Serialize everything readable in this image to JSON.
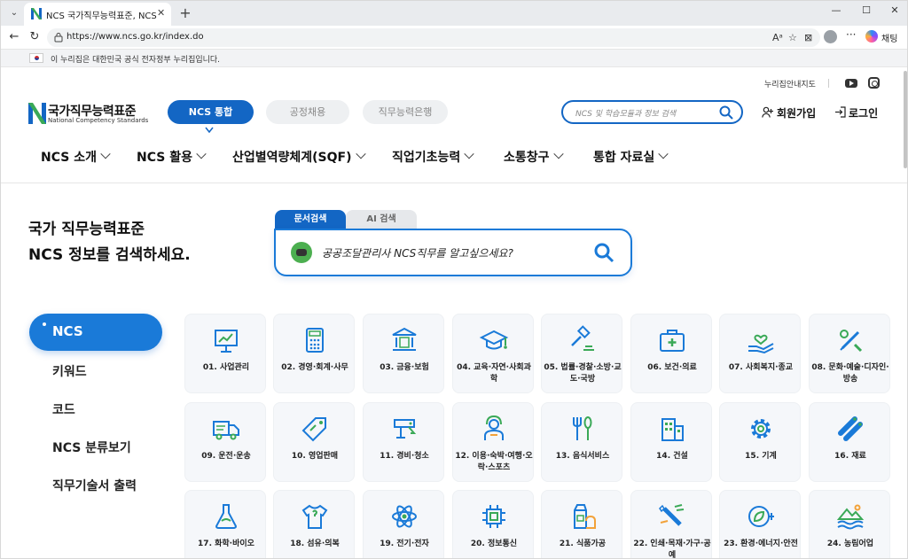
{
  "browser": {
    "tab_title": "NCS 국가직무능력표준, NCS 공정",
    "tab_close": "✕",
    "new_tab": "+",
    "url": "https://www.ncs.go.kr/index.do",
    "copilot_label": "채팅",
    "window_min": "—",
    "window_max": "☐",
    "window_close": "✕"
  },
  "gov_bar": {
    "text": "이 누리집은 대한민국 공식 전자정부 누리집입니다."
  },
  "util": {
    "sitemap": "누리집안내지도"
  },
  "logo": {
    "kor": "국가직무능력표준",
    "eng": "National Competency Standards"
  },
  "header_tabs": [
    {
      "label": "NCS 통합"
    },
    {
      "label": "공정채용"
    },
    {
      "label": "직무능력은행"
    }
  ],
  "header_search": {
    "placeholder": "NCS 및 학습모듈과 정보 검색"
  },
  "header_links": {
    "signup": "회원가입",
    "login": "로그인"
  },
  "main_nav": [
    {
      "label": "NCS 소개"
    },
    {
      "label": "NCS 활용"
    },
    {
      "label": "산업별역량체계(SQF)"
    },
    {
      "label": "직업기초능력"
    },
    {
      "label": "소통창구"
    },
    {
      "label": "통합 자료실"
    }
  ],
  "hero": {
    "line1": "국가 직무능력표준",
    "line2": "NCS 정보를 검색하세요.",
    "tabs": [
      {
        "label": "문서검색"
      },
      {
        "label": "AI 검색"
      }
    ],
    "placeholder": "공공조달관리사 NCS직무를 알고싶으세요?"
  },
  "sidebar": {
    "active": "NCS",
    "items": [
      {
        "label": "키워드"
      },
      {
        "label": "코드"
      },
      {
        "label": "NCS 분류보기"
      },
      {
        "label": "직무기술서 출력"
      }
    ]
  },
  "categories": [
    {
      "label": "01. 사업관리",
      "icon": "presentation-icon"
    },
    {
      "label": "02. 경영·회계·사무",
      "icon": "calculator-icon"
    },
    {
      "label": "03. 금융·보험",
      "icon": "bank-icon"
    },
    {
      "label": "04. 교육·자연·사회과학",
      "icon": "graduation-cap-icon"
    },
    {
      "label": "05. 법률·경찰·소방·교도·국방",
      "icon": "gavel-icon"
    },
    {
      "label": "06. 보건·의료",
      "icon": "medical-kit-icon"
    },
    {
      "label": "07. 사회복지·종교",
      "icon": "heart-hand-icon"
    },
    {
      "label": "08. 문화·예술·디자인·방송",
      "icon": "paint-brush-icon"
    },
    {
      "label": "09. 운전·운송",
      "icon": "truck-icon"
    },
    {
      "label": "10. 영업판매",
      "icon": "price-tag-icon"
    },
    {
      "label": "11. 경비·청소",
      "icon": "security-camera-icon"
    },
    {
      "label": "12. 이용·숙박·여행·오락·스포츠",
      "icon": "staff-icon"
    },
    {
      "label": "13. 음식서비스",
      "icon": "fork-spoon-icon"
    },
    {
      "label": "14. 건설",
      "icon": "building-icon"
    },
    {
      "label": "15. 기계",
      "icon": "gear-icon"
    },
    {
      "label": "16. 재료",
      "icon": "pipes-icon"
    },
    {
      "label": "17. 화학·바이오",
      "icon": "flask-icon"
    },
    {
      "label": "18. 섬유·의복",
      "icon": "shirt-icon"
    },
    {
      "label": "19. 전기·전자",
      "icon": "atom-icon"
    },
    {
      "label": "20. 정보통신",
      "icon": "chip-icon"
    },
    {
      "label": "21. 식품가공",
      "icon": "food-package-icon"
    },
    {
      "label": "22. 인쇄·목재·가구·공예",
      "icon": "saw-icon"
    },
    {
      "label": "23. 환경·에너지·안전",
      "icon": "eco-plug-icon"
    },
    {
      "label": "24. 농림어업",
      "icon": "farm-icon"
    }
  ],
  "colors": {
    "primary": "#1366c4",
    "accent": "#1a7ad8",
    "icon_green": "#3aa957",
    "icon_orange": "#f2a23a"
  }
}
